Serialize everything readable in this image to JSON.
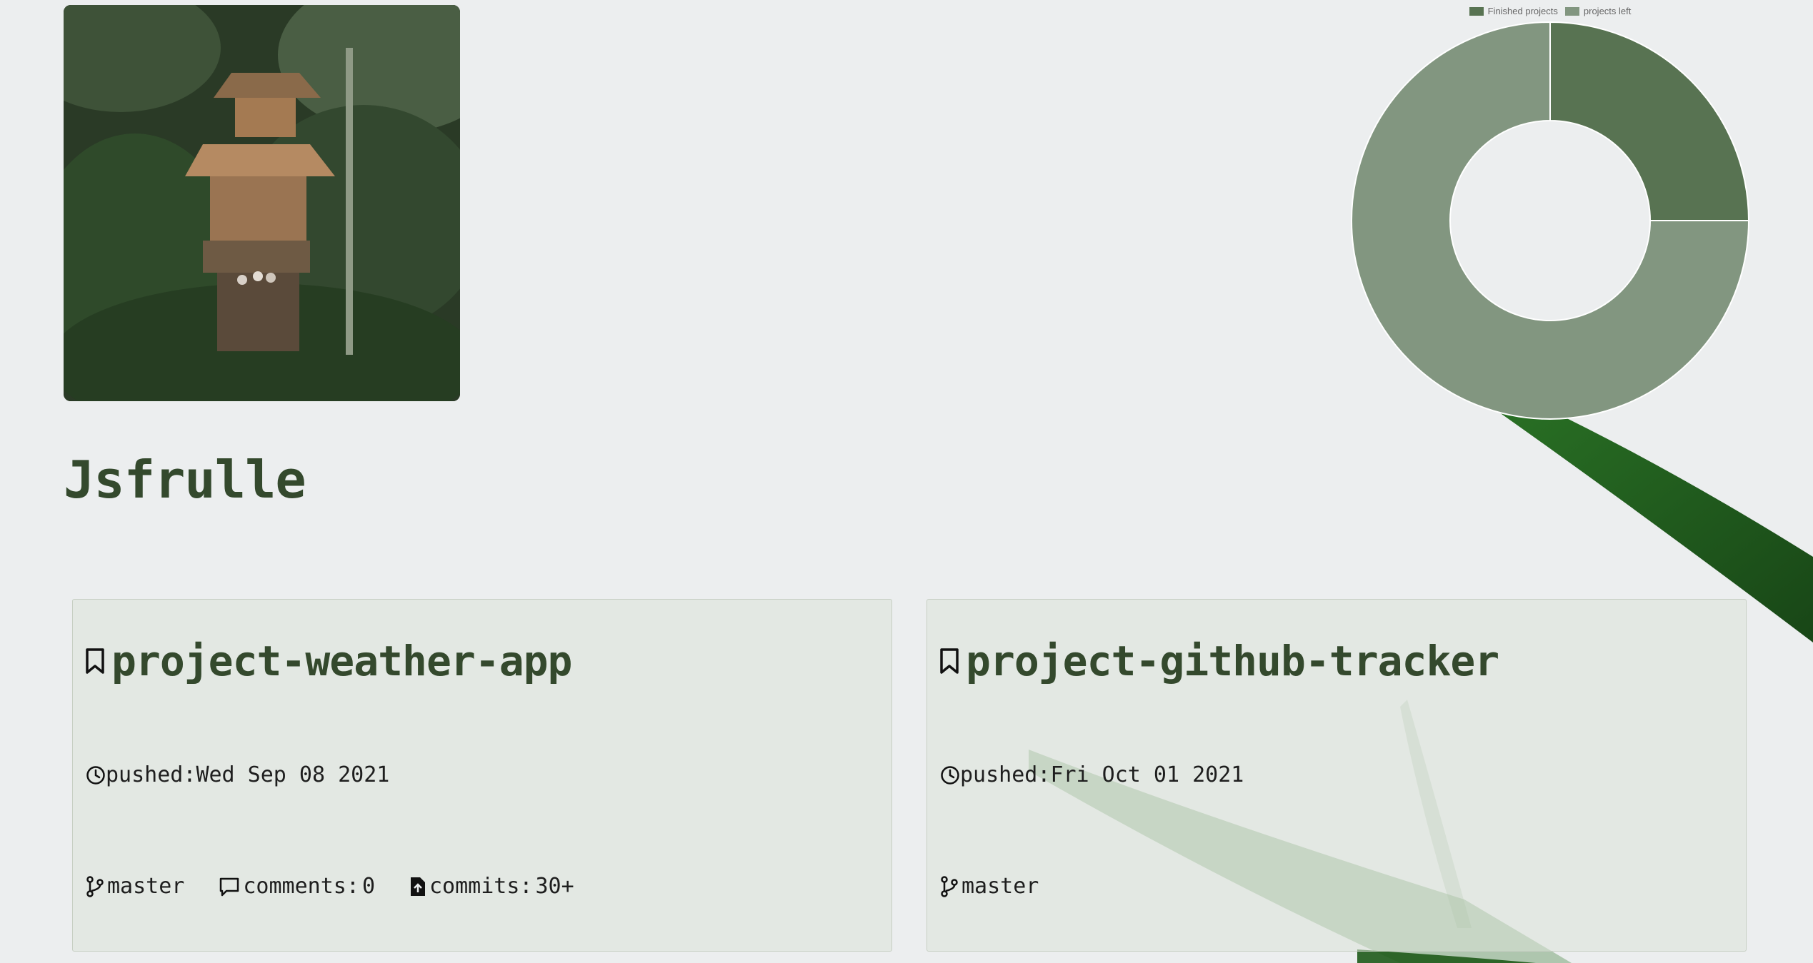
{
  "profile": {
    "username": "Jsfrulle",
    "photo_alt": "treehouse in jungle photo"
  },
  "chart_data": {
    "type": "pie",
    "variant": "doughnut",
    "labels": [
      "Finished projects",
      "projects left"
    ],
    "values": [
      2,
      6
    ],
    "colors": [
      "#587352",
      "#829680"
    ],
    "legend": "top"
  },
  "projects": [
    {
      "name": "project-weather-app",
      "pushed_label": "pushed:",
      "pushed_date": "Wed Sep 08 2021",
      "branch": "master",
      "comments_label": "comments:",
      "comments": "0",
      "commits_label": "commits: ",
      "commits": "30+"
    },
    {
      "name": "project-github-tracker",
      "pushed_label": "pushed:",
      "pushed_date": "Fri Oct 01 2021",
      "branch": "master"
    }
  ],
  "icons": {
    "bookmark": "bookmark-icon",
    "clock": "clock-icon",
    "branch": "git-branch-icon",
    "comment": "comment-icon",
    "commit": "file-upload-icon"
  },
  "colors": {
    "accent": "#34492d",
    "background": "#eceeef",
    "card_bg": "#dde3da"
  }
}
